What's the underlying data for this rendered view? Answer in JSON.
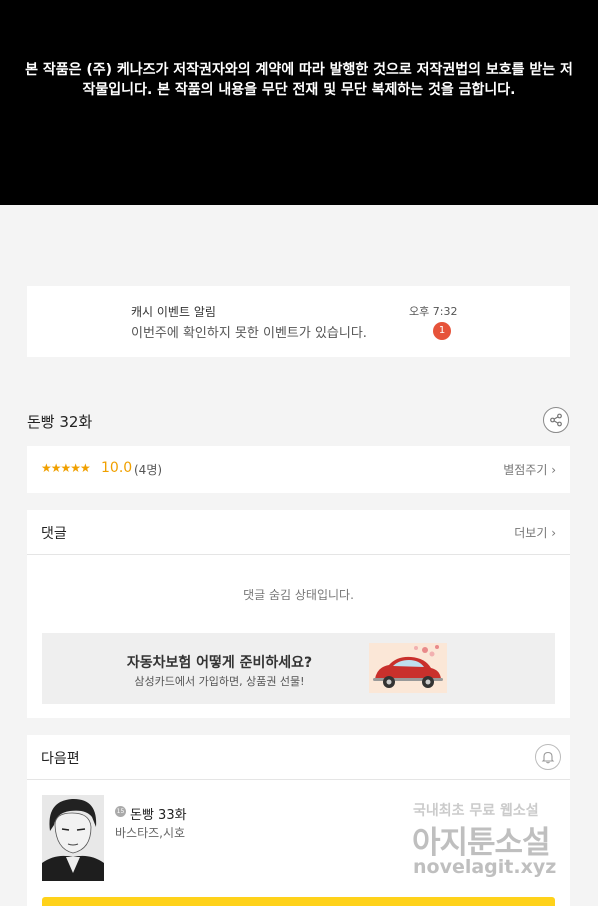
{
  "notice": {
    "text": "본 작품은 (주) 케나즈가 저작권자와의 계약에 따라 발행한 것으로 저작권법의 보호를 받는 저작물입니다. 본 작품의 내용을 무단 전재 및 무단 복제하는 것을 금합니다."
  },
  "push": {
    "title": "캐시 이벤트 알림",
    "body": "이번주에 확인하지 못한 이벤트가 있습니다.",
    "time": "오후 7:32",
    "badge": "1"
  },
  "episode": {
    "title": "돈빵 32화",
    "share_icon": "share-icon"
  },
  "rating": {
    "stars": "★★★★★",
    "score": "10.0",
    "count": "(4명)",
    "action": "별점주기 ›"
  },
  "comments": {
    "title": "댓글",
    "more": "더보기 ›",
    "hidden_message": "댓글 숨김 상태입니다."
  },
  "ad": {
    "title": "자동차보험 어떻게 준비하세요?",
    "subtitle": "삼성카드에서 가입하면, 상품권 선물!"
  },
  "next": {
    "title": "다음편",
    "episode": "돈빵 33화",
    "authors": "바스타즈,시호",
    "age_badge": "15",
    "bell_icon": "bell-icon"
  },
  "watermark": {
    "line1": "국내최초 무료 웹소설",
    "line2": "아지툰소설",
    "line3": "novelagit.xyz"
  },
  "colors": {
    "accent": "#f0a000",
    "badge": "#e6533a",
    "cta": "#ffd21a"
  }
}
